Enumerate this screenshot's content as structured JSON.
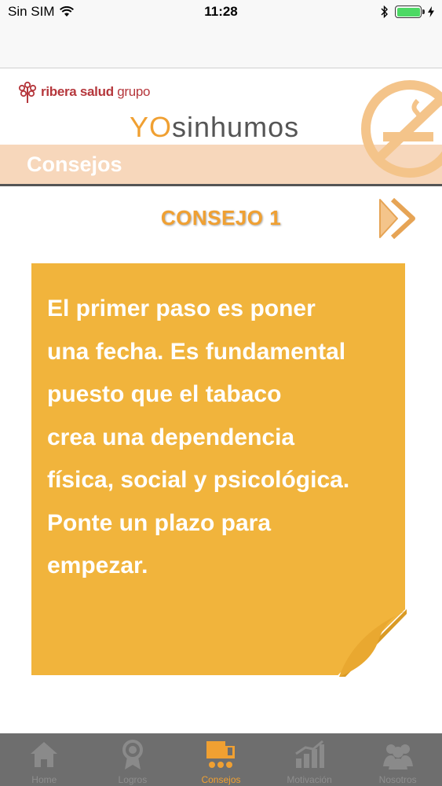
{
  "status_bar": {
    "carrier": "Sin SIM",
    "time": "11:28"
  },
  "header": {
    "brand_bold": "ribera salud",
    "brand_light": "grupo",
    "logo_yo": "YO",
    "logo_rest": "sinhumos",
    "section_title": "Consejos"
  },
  "content": {
    "tip_title": "CONSEJO 1",
    "tip_lines": [
      "El primer paso es poner",
      "una fecha. Es fundamental",
      "puesto que el tabaco",
      "crea una dependencia",
      "física, social y psicológica.",
      "Ponte un plazo para",
      "empezar."
    ]
  },
  "tab_bar": {
    "items": [
      {
        "label": "Home",
        "icon": "home-icon"
      },
      {
        "label": "Logros",
        "icon": "medal-icon"
      },
      {
        "label": "Consejos",
        "icon": "consejos-icon",
        "active": true
      },
      {
        "label": "Motivación",
        "icon": "chart-icon"
      },
      {
        "label": "Nosotros",
        "icon": "people-icon"
      }
    ]
  },
  "colors": {
    "accent": "#f0a032",
    "note": "#f1b43c",
    "band": "#f7d7bb",
    "brand": "#b5373c",
    "tab_bar": "#6e6e6e"
  }
}
